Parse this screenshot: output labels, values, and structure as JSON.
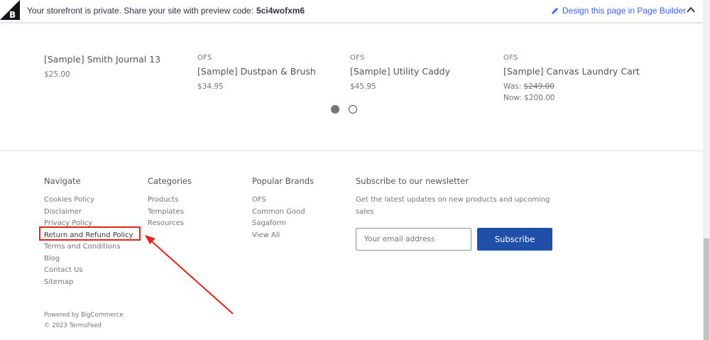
{
  "banner": {
    "text": "Your storefront is private. Share your site with preview code:",
    "code": "5ci4wofxm6",
    "page_builder_link": "Design this page in Page Builder"
  },
  "products": [
    {
      "brand": "",
      "name": "[Sample] Smith Journal 13",
      "price": "$25.00"
    },
    {
      "brand": "OFS",
      "name": "[Sample] Dustpan & Brush",
      "price": "$34.95"
    },
    {
      "brand": "OFS",
      "name": "[Sample] Utility Caddy",
      "price": "$45.95"
    },
    {
      "brand": "OFS",
      "name": "[Sample] Canvas Laundry Cart",
      "was_label": "Was:",
      "was_price": "$249.00",
      "now": "Now: $200.00"
    }
  ],
  "footer": {
    "navigate": {
      "heading": "Navigate",
      "links": [
        "Cookies Policy",
        "Disclaimer",
        "Privacy Policy",
        "Return and Refund Policy",
        "Terms and Conditions",
        "Blog",
        "Contact Us",
        "Sitemap"
      ]
    },
    "categories": {
      "heading": "Categories",
      "links": [
        "Products",
        "Templates",
        "Resources"
      ]
    },
    "brands": {
      "heading": "Popular Brands",
      "links": [
        "OFS",
        "Common Good",
        "Sagaform",
        "View All"
      ]
    },
    "newsletter": {
      "heading": "Subscribe to our newsletter",
      "text": "Get the latest updates on new products and upcoming sales",
      "email_placeholder": "Your email address",
      "button": "Subscribe"
    },
    "powered_by": "Powered by BigCommerce",
    "copyright": "© 2023 TermsFeed"
  },
  "colors": {
    "highlight": "#e5221c",
    "button": "#1f4fa8",
    "link_blue": "#3c64f4"
  },
  "icons": [
    "bigcommerce-logo-icon",
    "pencil-icon",
    "chevron-up-icon"
  ]
}
